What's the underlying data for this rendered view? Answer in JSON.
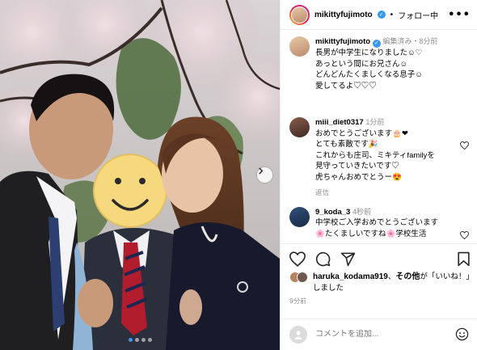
{
  "header": {
    "username": "mikittyfujimoto",
    "follow_label": "フォロー中",
    "more_label": "•••"
  },
  "caption": {
    "username": "mikittyfujimoto",
    "meta": "編集済み・8分前",
    "lines": [
      "長男が中学生になりました☺︎♡",
      "あっという間にお兄さん☺︎",
      "どんどんたくましくなる息子☺︎",
      "愛してるよ♡♡♡"
    ]
  },
  "comments": [
    {
      "username": "miii_diet0317",
      "time": "1分前",
      "lines": [
        "おめでとうございます🎂❤",
        "とても素敵です🎉",
        "これからも庄司、ミキティfamilyを",
        "見守っていきたいです♡",
        "虎ちゃんおめでとうー😍"
      ],
      "reply_label": "返信"
    },
    {
      "username": "9_koda_3",
      "time": "4秒前",
      "lines": [
        "中学校ご入学おめでとうございます",
        "🌸たくましいですね🌸学校生活"
      ]
    }
  ],
  "likes": {
    "user": "haruka_kodama919",
    "text_mid": "、",
    "others": "その他",
    "text_end": "が「いいね！」しました"
  },
  "post_time": "9分前",
  "add_comment": {
    "placeholder": "コメントを追加..."
  },
  "icons": {
    "like": "heart-icon",
    "comment": "comment-icon",
    "share": "share-icon",
    "save": "bookmark-icon",
    "emoji": "emoji-icon",
    "next": "chevron-right-icon"
  },
  "carousel": {
    "total": 4,
    "active": 0
  },
  "colors": {
    "verified": "#3897f0",
    "secondary_text": "#8e8e8e",
    "divider": "#efefef"
  }
}
